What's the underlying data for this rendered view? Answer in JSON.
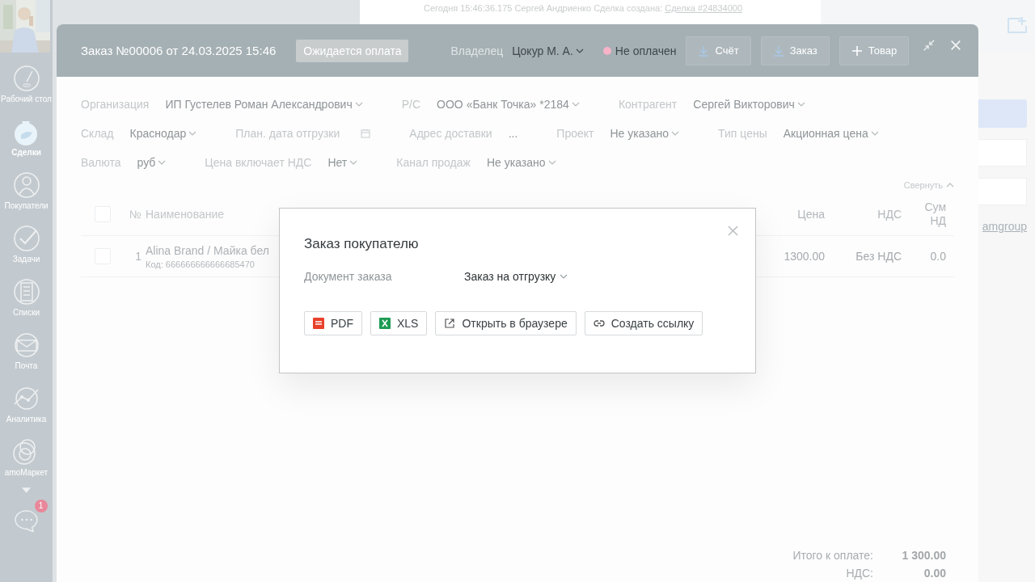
{
  "nav": {
    "items": [
      {
        "label": "Рабочий стол",
        "kind": "dashboard",
        "selected": false
      },
      {
        "label": "Сделки",
        "kind": "deals",
        "selected": true
      },
      {
        "label": "Покупатели",
        "kind": "customers",
        "selected": false
      },
      {
        "label": "Задачи",
        "kind": "tasks",
        "selected": false
      },
      {
        "label": "Списки",
        "kind": "lists",
        "selected": false
      },
      {
        "label": "Почта",
        "kind": "mail",
        "selected": false
      },
      {
        "label": "Аналитика",
        "kind": "analytics",
        "selected": false
      },
      {
        "label": "amoМаркет",
        "kind": "market",
        "selected": false
      }
    ],
    "chat_badge": "1"
  },
  "timeline": {
    "text": "Сегодня 15:46:36.175 Сергей Андриенко Сделка создана:",
    "link": "Сделка #24834000"
  },
  "side_panel": {
    "link": "amgroup"
  },
  "order": {
    "title": "Заказ №00006 от 24.03.2025 15:46",
    "status": "Ожидается оплата",
    "owner_label": "Владелец",
    "owner": "Цокур М. А.",
    "payment": {
      "label": "Не оплачен",
      "color": "#f7b3c7"
    },
    "buttons": [
      {
        "label": "Счёт",
        "kind": "download"
      },
      {
        "label": "Заказ",
        "kind": "download"
      },
      {
        "label": "Товар",
        "kind": "add"
      }
    ],
    "field_rows": [
      [
        {
          "label": "Организация",
          "value": "ИП Густелев Роман Александрович",
          "kind": "dropdown"
        },
        {
          "label": "Р/С",
          "value": "ООО «Банк Точка» *2184",
          "kind": "dropdown"
        },
        {
          "label": "Контрагент",
          "value": "Сергей Викторович",
          "kind": "dropdown"
        }
      ],
      [
        {
          "label": "Склад",
          "value": "Краснодар",
          "kind": "dropdown"
        },
        {
          "label": "План. дата отгрузки",
          "kind": "date"
        },
        {
          "label": "Адрес доставки",
          "value": "...",
          "kind": "text"
        },
        {
          "label": "Проект",
          "value": "Не указано",
          "kind": "dropdown"
        },
        {
          "label": "Тип цены",
          "value": "Акционная цена",
          "kind": "dropdown"
        }
      ],
      [
        {
          "label": "Валюта",
          "value": "руб",
          "kind": "dropdown"
        },
        {
          "label": "Цена включает НДС",
          "value": "Нет",
          "kind": "dropdown"
        },
        {
          "label": "Канал продаж",
          "value": "Не указано",
          "kind": "dropdown"
        }
      ]
    ],
    "collapse_link": "Свернуть",
    "table": {
      "select_all": {
        "checked": false
      },
      "columns": {
        "number": "№",
        "name": "Наименование",
        "price": "Цена",
        "vat": "НДС",
        "column_10": "Сум НД"
      },
      "rows": [
        {
          "checked": false,
          "number": "1",
          "name": "Alina Brand / Майка бел",
          "code": "Код: 666666666666685470",
          "price": "1300.00",
          "vat": "Без НДС",
          "column_10": "0.0"
        }
      ]
    },
    "totals": [
      {
        "label": "Итого к оплате:",
        "value": "1 300.00"
      },
      {
        "label": "НДС:",
        "value": "0.00"
      }
    ]
  },
  "dialog": {
    "title": "Заказ покупателю",
    "field_label": "Документ заказа",
    "field_value": "Заказ на отгрузку",
    "buttons": [
      {
        "label": "PDF",
        "kind": "pdf"
      },
      {
        "label": "XLS",
        "kind": "xls"
      },
      {
        "label": "Открыть в браузере",
        "kind": "external"
      },
      {
        "label": "Создать ссылку",
        "kind": "link"
      }
    ]
  }
}
